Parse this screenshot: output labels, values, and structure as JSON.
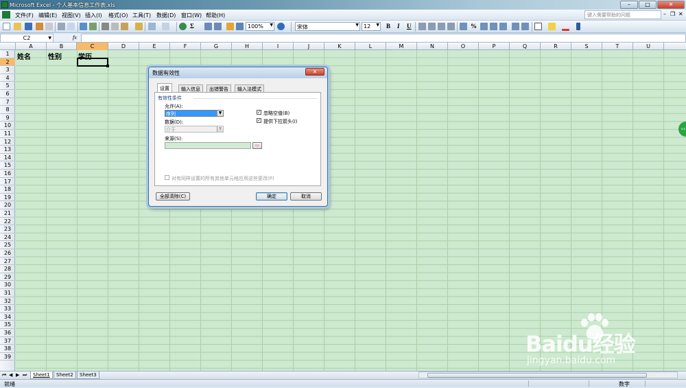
{
  "window": {
    "title": "Microsoft Excel - 个人基本信息工作表.xls"
  },
  "menu": {
    "items": [
      "文件(F)",
      "编辑(E)",
      "视图(V)",
      "插入(I)",
      "格式(O)",
      "工具(T)",
      "数据(D)",
      "窗口(W)",
      "帮助(H)"
    ],
    "help_placeholder": "键入需要帮助的问题"
  },
  "toolbar": {
    "zoom": "100%",
    "font_name": "宋体",
    "font_size": "12",
    "bold": "B",
    "italic": "I",
    "underline": "U",
    "percent": "%",
    "sigma": "Σ"
  },
  "formula_bar": {
    "name_box": "C2",
    "fx": "fx",
    "content": ""
  },
  "sheet": {
    "columns": [
      "A",
      "B",
      "C",
      "D",
      "E",
      "F",
      "G",
      "H",
      "I",
      "J",
      "K",
      "L",
      "M",
      "N",
      "O",
      "P",
      "Q",
      "R",
      "S",
      "T",
      "U"
    ],
    "rows": [
      "1",
      "2",
      "3",
      "4",
      "5",
      "6",
      "7",
      "8",
      "9",
      "10",
      "11",
      "12",
      "13",
      "14",
      "15",
      "16",
      "17",
      "18",
      "19",
      "20",
      "21",
      "22",
      "23",
      "24",
      "25",
      "26",
      "27",
      "28",
      "29",
      "30",
      "31",
      "32",
      "33",
      "34",
      "35",
      "36",
      "37",
      "38",
      "39"
    ],
    "cells": {
      "A1": "姓名",
      "B1": "性别",
      "C1": "学历"
    },
    "selected_cell": "C2"
  },
  "tabs": [
    "Sheet1",
    "Sheet2",
    "Sheet3"
  ],
  "status": {
    "left": "就绪",
    "mode": "数字"
  },
  "dialog": {
    "title": "数据有效性",
    "close": "✕",
    "tabs": [
      "设置",
      "输入信息",
      "出错警告",
      "输入法模式"
    ],
    "group": "有效性条件",
    "allow_label": "允许(A):",
    "allow_value": "序列",
    "data_label": "数据(D):",
    "data_value": "介于",
    "source_label": "来源(S):",
    "ignore_blank": "忽略空值(B)",
    "dropdown": "提供下拉箭头(I)",
    "apply_all": "对有同样设置的所有其他单元格应用这些更改(P)",
    "clear_all": "全部清除(C)",
    "ok": "确定",
    "cancel": "取消"
  },
  "watermark": {
    "brand": "Baidu经验",
    "url": "jingyan.baidu.com"
  }
}
